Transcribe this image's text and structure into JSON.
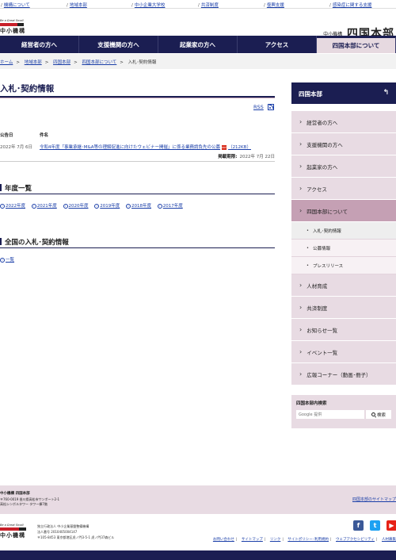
{
  "util_links": [
    {
      "label": "機構について"
    },
    {
      "label": "地域本部"
    },
    {
      "label": "中小企業大学校"
    },
    {
      "label": "共済制度"
    },
    {
      "label": "復興支援"
    },
    {
      "label": "感染症に関する支援"
    }
  ],
  "header": {
    "tagline": "Be a Great Small",
    "logo_text": "中小機構",
    "org_name": "中小機構",
    "region_title": "四国本部"
  },
  "gnav": [
    {
      "label": "経営者の方へ"
    },
    {
      "label": "支援機関の方へ"
    },
    {
      "label": "起業家の方へ"
    },
    {
      "label": "アクセス"
    },
    {
      "label": "四国本部について"
    }
  ],
  "breadcrumb": {
    "items": [
      "ホーム",
      "地域本部",
      "四国本部",
      "四国本部について"
    ],
    "sep": ">",
    "current": "入札･契約情報"
  },
  "main": {
    "title": "入札･契約情報",
    "rss_label": "RSS",
    "table_headers": {
      "date": "公告日",
      "subject": "件名"
    },
    "notice": {
      "date": "2022年 7月 6日",
      "title": "令和4年度「事業承継･M&A等の理解促進に向けたウェビナー開催」に係る業務請負先の公募",
      "pdf_label": "PDF",
      "size": "（212KB）",
      "deadline_label": "掲載期限:",
      "deadline": "2022年 7月 22日"
    },
    "section_years": "年度一覧",
    "years": [
      "2022年度",
      "2021年度",
      "2020年度",
      "2019年度",
      "2018年度",
      "2017年度"
    ],
    "section_national": "全国の入札･契約情報",
    "national_link": "一覧"
  },
  "sidebar": {
    "heading": "四国本部",
    "back_icon": "↰",
    "items": [
      {
        "label": "経営者の方へ"
      },
      {
        "label": "支援機関の方へ"
      },
      {
        "label": "起業家の方へ"
      },
      {
        "label": "アクセス"
      },
      {
        "label": "四国本部について"
      },
      {
        "label": "入札･契約情報"
      },
      {
        "label": "公募情報"
      },
      {
        "label": "プレスリリース"
      },
      {
        "label": "人材育成"
      },
      {
        "label": "共済制度"
      },
      {
        "label": "お知らせ一覧"
      },
      {
        "label": "イベント一覧"
      },
      {
        "label": "広報コーナー（動画･冊子）"
      }
    ],
    "search": {
      "label": "四国本部内検索",
      "placeholder": "Google 提供",
      "button": "検索"
    }
  },
  "footer": {
    "org": "中小機構 四国本部",
    "address1": "〒760-0019 香川県高松市サンポート2-1",
    "address2": "高松シンボルタワー タワー棟7階",
    "sitemap": "四国本部のサイトマップ",
    "tagline": "Be a Great Small",
    "logo_text": "中小機構",
    "info1": "独立行政法人 中小企業基盤整備機構",
    "info2": "法人番号 2010405004147",
    "info3": "〒105-8453 東京都港区虎ノ門3-5-1 虎ノ門37森ビル",
    "social": {
      "facebook": "f",
      "twitter": "t",
      "youtube": "▶"
    },
    "links": [
      "お問い合わせ",
      "サイトマップ",
      "リンク",
      "サイトポリシー･利用規約",
      "ウェブアクセシビリティ",
      "人材募集"
    ]
  }
}
